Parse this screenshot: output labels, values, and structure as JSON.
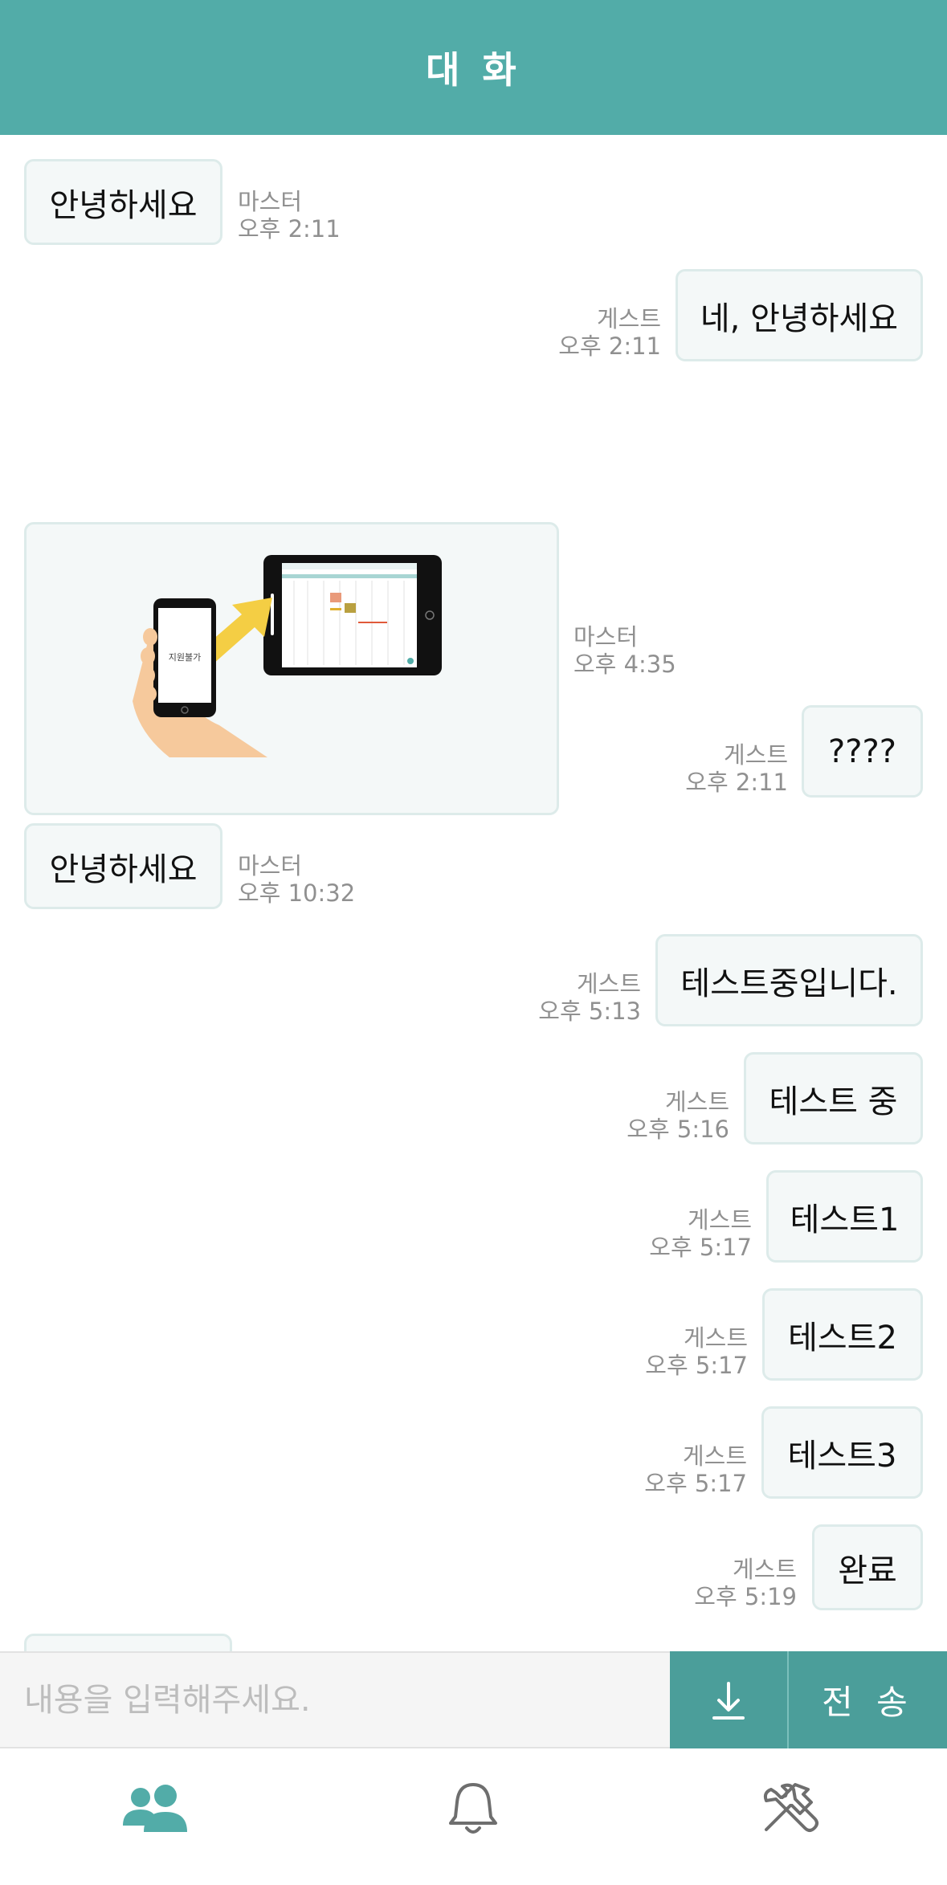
{
  "header": {
    "title": "대 화"
  },
  "messages": [
    {
      "text": "안녕하세요",
      "sender": "마스터",
      "time": "오후 2:11"
    },
    {
      "text": "네, 안녕하세요",
      "sender": "게스트",
      "time": "오후 2:11"
    },
    {
      "image_label": "지원불가",
      "sender": "마스터",
      "time": "오후 4:35"
    },
    {
      "text": "????",
      "sender": "게스트",
      "time": "오후 2:11"
    },
    {
      "text": "안녕하세요",
      "sender": "마스터",
      "time": "오후 10:32"
    },
    {
      "text": "테스트중입니다.",
      "sender": "게스트",
      "time": "오후 5:13"
    },
    {
      "text": "테스트 중",
      "sender": "게스트",
      "time": "오후 5:16"
    },
    {
      "text": "테스트1",
      "sender": "게스트",
      "time": "오후 5:17"
    },
    {
      "text": "테스트2",
      "sender": "게스트",
      "time": "오후 5:17"
    },
    {
      "text": "테스트3",
      "sender": "게스트",
      "time": "오후 5:17"
    },
    {
      "text": "완료",
      "sender": "게스트",
      "time": "오후 5:19"
    }
  ],
  "composer": {
    "placeholder": "내용을 입력해주세요.",
    "value": "",
    "send_label": "전 송",
    "download_icon": "download-icon"
  },
  "tabs": [
    {
      "icon": "users-icon"
    },
    {
      "icon": "bell-icon"
    },
    {
      "icon": "tools-icon"
    }
  ],
  "colors": {
    "accent": "#52ACA8",
    "button": "#4B9E9A",
    "bubble_bg": "#F4F8F8",
    "bubble_border": "#DDEBEA",
    "meta_text": "#909090"
  }
}
